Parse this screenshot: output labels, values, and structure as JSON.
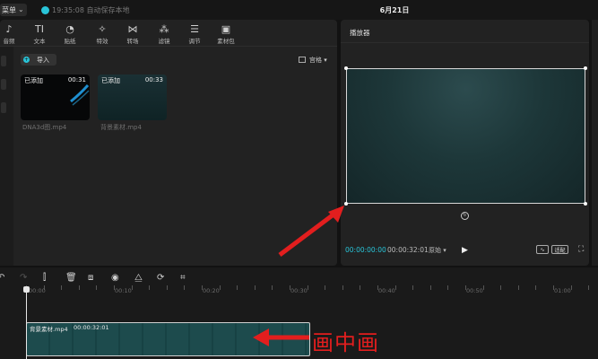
{
  "topbar": {
    "menu_label": "菜单",
    "autosave_text": "19:35:08 自动保存本地",
    "date_title": "6月21日"
  },
  "toolbar": {
    "items": [
      {
        "icon": "audio-icon",
        "glyph": "♪",
        "label": "音频"
      },
      {
        "icon": "text-icon",
        "glyph": "TI",
        "label": "文本"
      },
      {
        "icon": "sticker-icon",
        "glyph": "◔",
        "label": "贴纸"
      },
      {
        "icon": "effects-icon",
        "glyph": "✧",
        "label": "特效"
      },
      {
        "icon": "transition-icon",
        "glyph": "⋈",
        "label": "转场"
      },
      {
        "icon": "filter-icon",
        "glyph": "⁂",
        "label": "滤镜"
      },
      {
        "icon": "adjust-icon",
        "glyph": "☰",
        "label": "调节"
      },
      {
        "icon": "material-pack-icon",
        "glyph": "▣",
        "label": "素材包"
      }
    ]
  },
  "media": {
    "import_label": "导入",
    "sort_label": "宫格",
    "clips": [
      {
        "badge": "已添加",
        "duration": "00:31",
        "filename": "DNA3d图.mp4"
      },
      {
        "badge": "已添加",
        "duration": "00:33",
        "filename": "背景素材.mp4"
      }
    ]
  },
  "player": {
    "title": "播放器",
    "current_time": "00:00:00:00",
    "total_time": "00:00:32:01",
    "ratio_label": "原始",
    "pill_a": "",
    "pill_b": "适配"
  },
  "timeline": {
    "ruler_labels": [
      "00:00",
      "00:10",
      "00:20",
      "00:30",
      "00:40",
      "00:50",
      "01:00"
    ],
    "clip_name": "背景素材.mp4",
    "clip_duration": "00:00:32:01"
  },
  "annotation": {
    "text": "画中画",
    "color": "#e21e1e"
  },
  "colors": {
    "accent": "#29c4d8",
    "clip_teal": "#1d4b4d"
  }
}
